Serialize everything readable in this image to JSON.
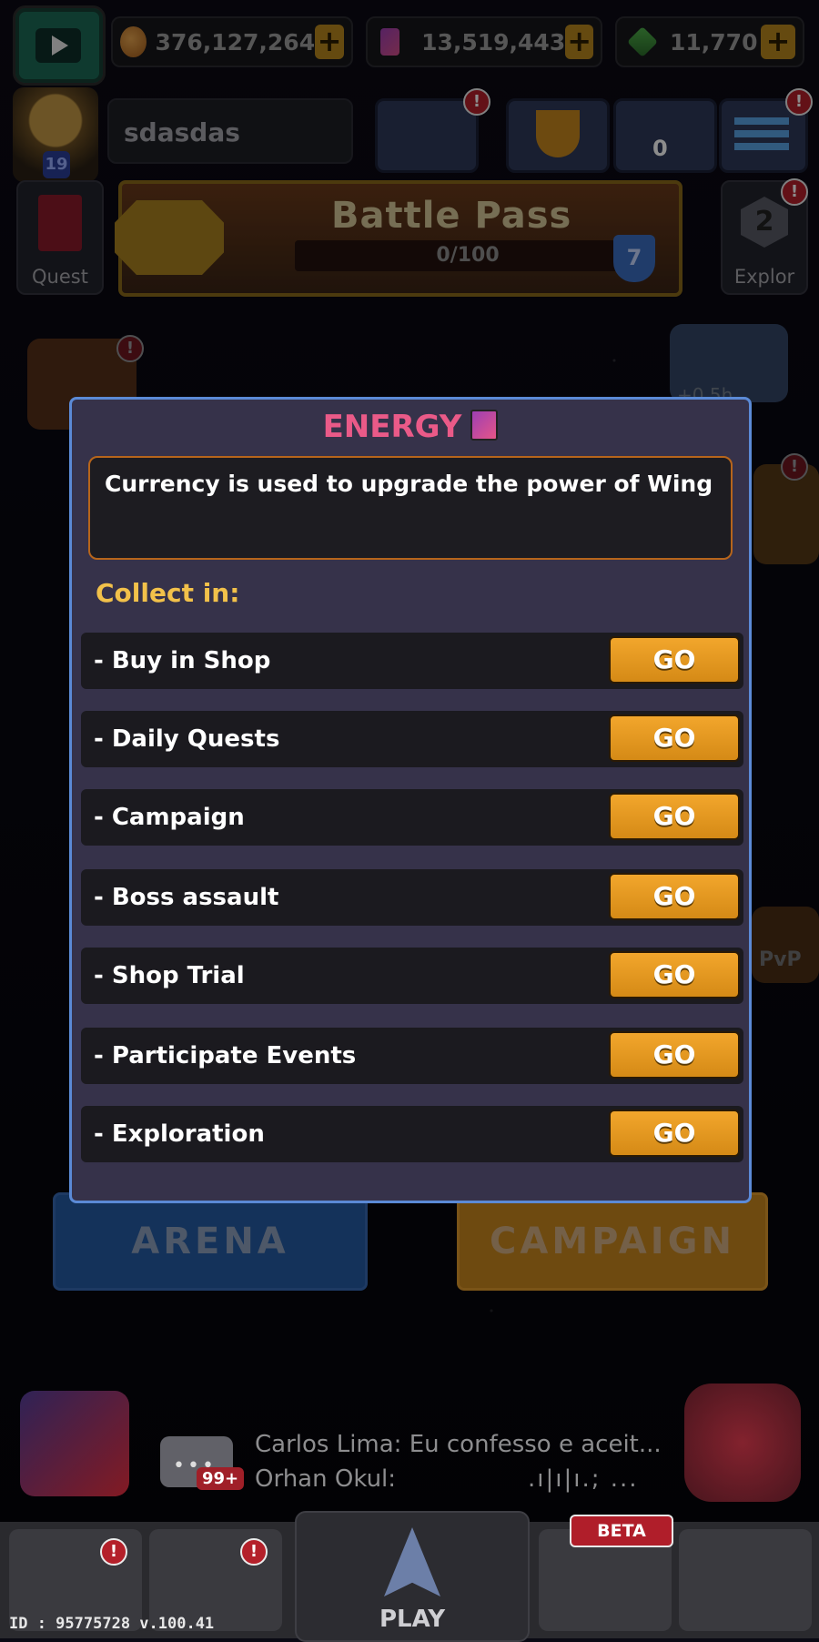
{
  "currencies": {
    "coins": "376,127,264",
    "energy": "13,519,443",
    "gems": "11,770",
    "plus_label": "+"
  },
  "profile": {
    "name": "sdasdas",
    "level": "19"
  },
  "badges": {
    "alert": "!",
    "friends_count": "0"
  },
  "quest": {
    "label": "Quest"
  },
  "battle_pass": {
    "title": "Battle Pass",
    "progress": "0/100",
    "tier": "7"
  },
  "exploration": {
    "label": "Explor",
    "count": "2"
  },
  "event_timer": "+0.5h",
  "pvp_label": "PvP",
  "modal": {
    "title": "ENERGY",
    "description": "Currency is used to upgrade the power of Wing",
    "collect_label": "Collect in:",
    "sources": [
      {
        "label": "- Buy in Shop",
        "button": "GO"
      },
      {
        "label": "- Daily Quests",
        "button": "GO"
      },
      {
        "label": "- Campaign",
        "button": "GO"
      },
      {
        "label": "- Boss assault",
        "button": "GO"
      },
      {
        "label": "- Shop Trial",
        "button": "GO"
      },
      {
        "label": "- Participate Events",
        "button": "GO"
      },
      {
        "label": "- Exploration",
        "button": "GO"
      }
    ]
  },
  "modes": {
    "arena": "ARENA",
    "campaign": "CAMPAIGN"
  },
  "chat": {
    "line1": "Carlos Lima: Eu confesso e aceit...",
    "line2": "Orhan Okul:",
    "line2_extra": ".ı|ı|ı.; ...",
    "count": "99+",
    "dots": "•••"
  },
  "nav": {
    "play": "PLAY",
    "beta": "BETA"
  },
  "footer_id": "ID : 95775728 v.100.41"
}
